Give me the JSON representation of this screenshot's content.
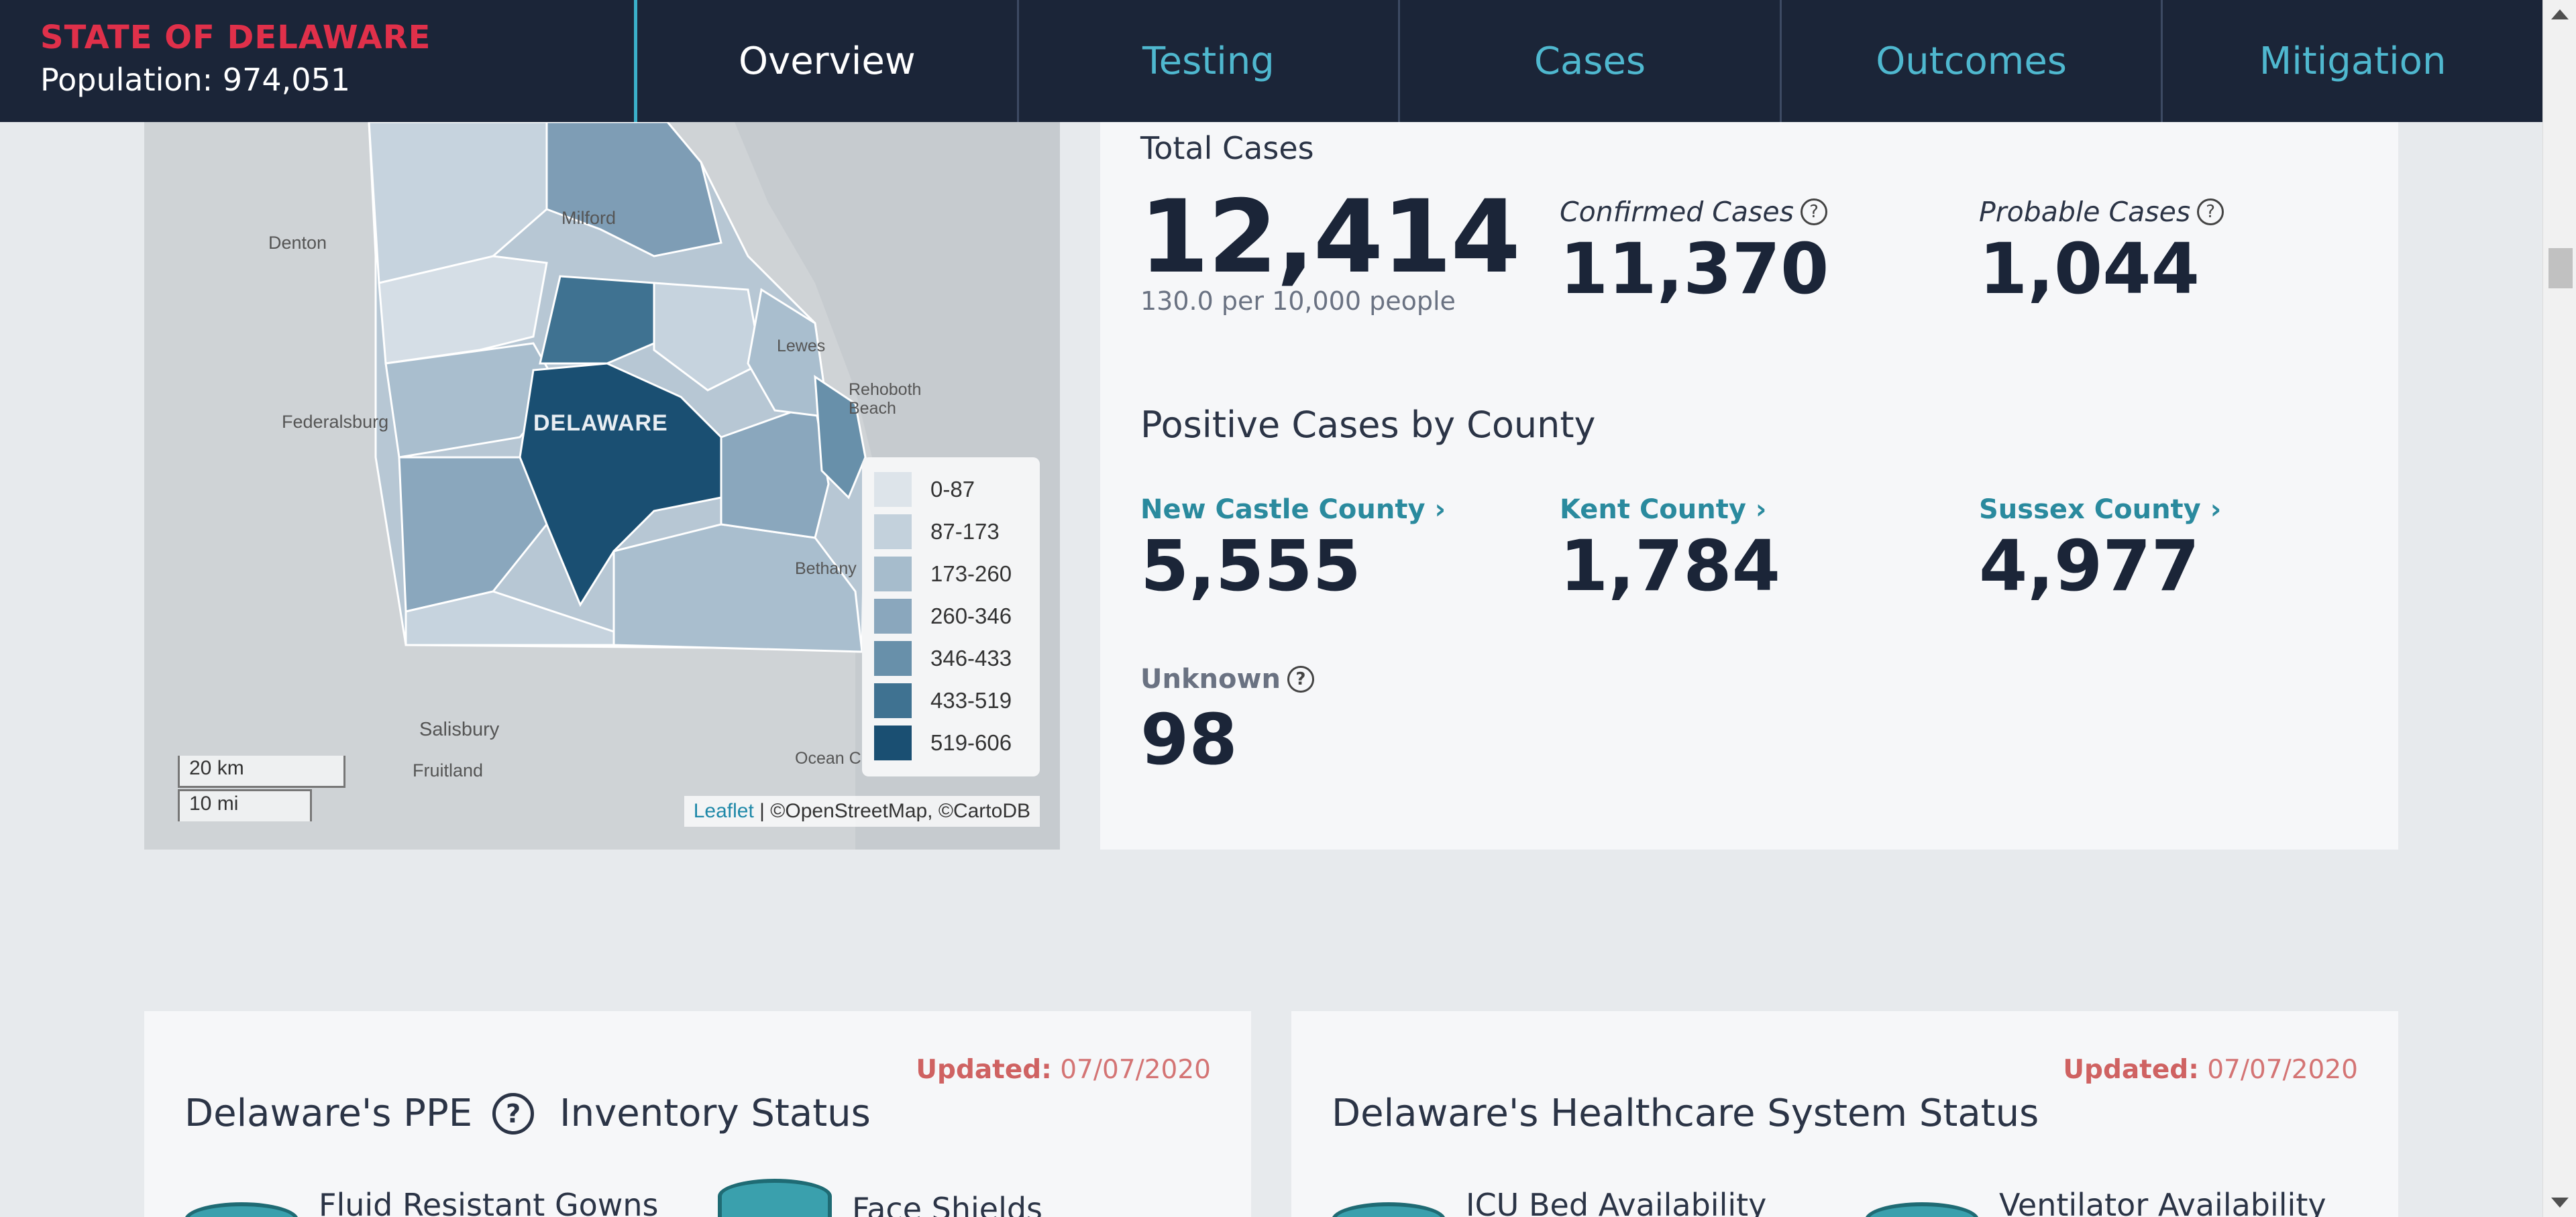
{
  "header": {
    "brand": "STATE OF DELAWARE",
    "population": "Population: 974,051",
    "tabs": [
      "Overview",
      "Testing",
      "Cases",
      "Outcomes",
      "Mitigation"
    ],
    "active_tab": "Overview"
  },
  "map": {
    "places": [
      "Milford",
      "Denton",
      "Lewes",
      "Rehoboth Beach",
      "DELAWARE",
      "Federalsburg",
      "Bethany",
      "Salisbury",
      "Fruitland",
      "Ocean City"
    ],
    "legend": [
      {
        "range": "0-87",
        "color": "#dde4ea"
      },
      {
        "range": "87-173",
        "color": "#c3d1dc"
      },
      {
        "range": "173-260",
        "color": "#a6bccc"
      },
      {
        "range": "260-346",
        "color": "#8aa7bd"
      },
      {
        "range": "346-433",
        "color": "#6890aa"
      },
      {
        "range": "433-519",
        "color": "#3f7291"
      },
      {
        "range": "519-606",
        "color": "#1a4f72"
      }
    ],
    "scale_km": "20 km",
    "scale_mi": "10 mi",
    "attribution_link": "Leaflet",
    "attribution_text": " | ©OpenStreetMap, ©CartoDB"
  },
  "cases": {
    "total_label": "Total Cases",
    "total_value": "12,414",
    "total_rate": "130.0 per 10,000 people",
    "confirmed_label": "Confirmed Cases",
    "confirmed_value": "11,370",
    "probable_label": "Probable Cases",
    "probable_value": "1,044",
    "by_county_title": "Positive Cases by County",
    "counties": [
      {
        "name": "New Castle County",
        "value": "5,555"
      },
      {
        "name": "Kent County",
        "value": "1,784"
      },
      {
        "name": "Sussex County",
        "value": "4,977"
      }
    ],
    "unknown_label": "Unknown",
    "unknown_value": "98"
  },
  "ppe_card": {
    "updated_label": "Updated:",
    "updated_date": "07/07/2020",
    "title_left": "Delaware's PPE",
    "title_right": "Inventory Status",
    "items": [
      "Fluid Resistant Gowns",
      "Face Shields"
    ]
  },
  "healthcare_card": {
    "updated_label": "Updated:",
    "updated_date": "07/07/2020",
    "title": "Delaware's Healthcare System Status",
    "items": [
      "ICU Bed Availability",
      "Ventilator Availability"
    ]
  },
  "icons": {
    "help": "question-circle-icon",
    "chevron": "chevron-right-icon"
  },
  "colors": {
    "header_bg": "#1b2538",
    "brand_red": "#e0304a",
    "accent_teal": "#4fb8cf",
    "link_teal": "#2a8a9e",
    "updated_red": "#d47474"
  }
}
